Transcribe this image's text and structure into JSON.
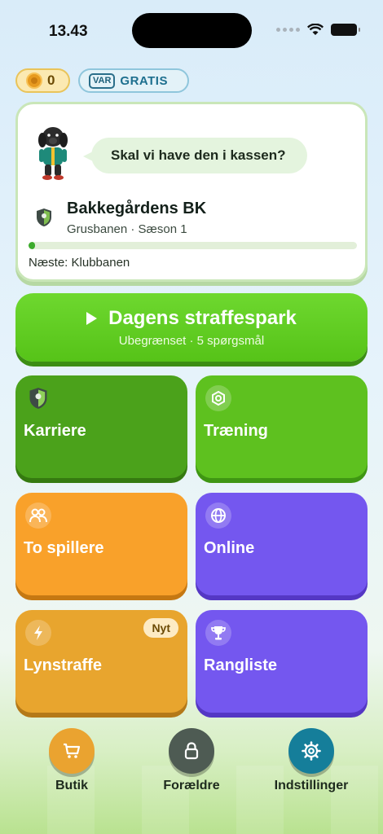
{
  "status_bar": {
    "time": "13.43"
  },
  "top": {
    "coins": "0",
    "free_badge_prefix": "VAR",
    "free_badge_label": "GRATIS"
  },
  "club_card": {
    "speech": "Skal vi have den i kassen?",
    "club_name": "Bakkegårdens BK",
    "club_subtitle": "Grusbanen · Sæson 1",
    "progress_fraction": 0.02,
    "next_label": "Næste: Klubbanen"
  },
  "daily": {
    "title": "Dagens straffespark",
    "subtitle": "Ubegrænset · 5 spørgsmål"
  },
  "tiles": [
    {
      "label": "Karriere",
      "icon": "shield-icon"
    },
    {
      "label": "Træning",
      "icon": "target-icon"
    },
    {
      "label": "To spillere",
      "icon": "two-players-icon"
    },
    {
      "label": "Online",
      "icon": "globe-icon"
    },
    {
      "label": "Lynstraffe",
      "icon": "lightning-icon",
      "badge": "Nyt"
    },
    {
      "label": "Rangliste",
      "icon": "trophy-icon"
    }
  ],
  "bottom_nav": [
    {
      "label": "Butik",
      "icon": "cart-icon"
    },
    {
      "label": "Forældre",
      "icon": "lock-icon"
    },
    {
      "label": "Indstillinger",
      "icon": "gear-icon"
    }
  ],
  "colors": {
    "primary_green": "#56c318",
    "career_green": "#4ba21b",
    "orange": "#f9a12a",
    "purple": "#7457ef",
    "teal": "#157e9a"
  }
}
